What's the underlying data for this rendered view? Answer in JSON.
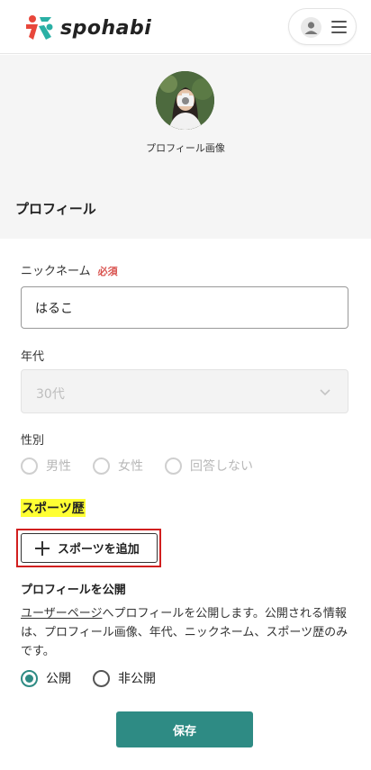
{
  "brand": {
    "name": "spohabi",
    "accent": "#2e8b84",
    "logo_colors": [
      "#e8473b",
      "#2ab0a5"
    ]
  },
  "header": {
    "user_icon": "user-icon",
    "menu_icon": "hamburger-menu-icon"
  },
  "profile_image": {
    "caption": "プロフィール画像",
    "icon": "camera-icon"
  },
  "section_title": "プロフィール",
  "nickname": {
    "label": "ニックネーム",
    "required": "必須",
    "value": "はるこ"
  },
  "age": {
    "label": "年代",
    "value": "30代"
  },
  "gender": {
    "label": "性別",
    "options": [
      "男性",
      "女性",
      "回答しない"
    ]
  },
  "sports": {
    "title": "スポーツ歴",
    "add_label": "スポーツを追加"
  },
  "publish": {
    "title": "プロフィールを公開",
    "desc_link": "ユーザーページ",
    "desc_rest": "へプロフィールを公開します。公開される情報は、プロフィール画像、年代、ニックネーム、スポーツ歴のみです。",
    "options": [
      "公開",
      "非公開"
    ],
    "selected": "公開"
  },
  "save_label": "保存"
}
